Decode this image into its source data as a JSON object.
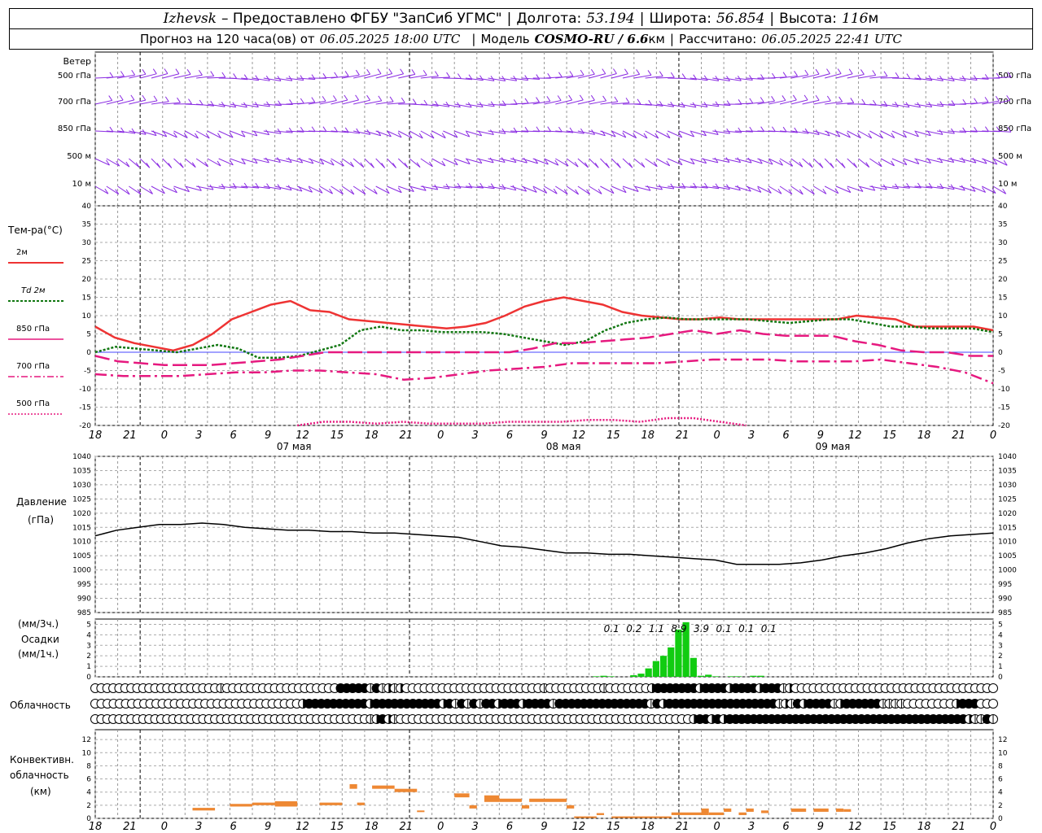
{
  "header": {
    "city": "Izhevsk",
    "provider": "– Предоставлено ФГБУ \"ЗапСиб УГМС\"",
    "lon_label": "Долгота:",
    "lon_value": "53.194",
    "lat_label": "Широта:",
    "lat_value": "56.854",
    "alt_label": "Высота:",
    "alt_value": "116",
    "alt_unit": "м",
    "forecast_prefix": "Прогноз на 120 часа(ов) от",
    "forecast_time": "06.05.2025 18:00 UTC",
    "model_label": "Модель",
    "model_value": "COSMO-RU / 6.6",
    "model_unit": "км",
    "computed_label": "Рассчитано:",
    "computed_time": "06.05.2025 22:41 UTC"
  },
  "colors": {
    "wind": "#8a2be2",
    "t2m": "#ee3333",
    "td2m": "#117711",
    "magenta": "#e6197f",
    "pressure": "#000000",
    "precip": "#11cc11",
    "conv": "#ee8833"
  },
  "labels": {
    "wind_title": "Ветер",
    "wind_levels": [
      "500 гПа",
      "700 гПа",
      "850 гПа",
      "500 м",
      "10  м"
    ],
    "temp_title": "Тем-ра(°C)",
    "legend": [
      "2м",
      "Td 2м",
      "850 гПа",
      "700 гПа",
      "500 гПа"
    ],
    "pressure_title": "Давление",
    "pressure_unit": "(гПа)",
    "precip_unit1": "(мм/3ч.)",
    "precip_title": "Осадки",
    "precip_unit2": "(мм/1ч.)",
    "cloud_title": "Облачность",
    "conv_title1": "Конвективн.",
    "conv_title2": "облачность",
    "conv_title3": "(км)"
  },
  "time_axis": {
    "ticks": [
      "18",
      "21",
      "0",
      "3",
      "6",
      "9",
      "12",
      "15",
      "18",
      "21",
      "0",
      "3",
      "6",
      "9",
      "12",
      "15",
      "18",
      "21",
      "0",
      "3",
      "6",
      "9",
      "12",
      "15",
      "18",
      "21",
      "0"
    ],
    "dates": [
      "07 мая",
      "08 мая",
      "09 мая"
    ]
  },
  "chart_data": [
    {
      "type": "line",
      "title": "Тем-ра(°C)",
      "ylim": [
        -20,
        40
      ],
      "yticks": [
        "40",
        "35",
        "30",
        "25",
        "20",
        "15",
        "10",
        "5",
        "0",
        "-5",
        "-10",
        "-15",
        "-20"
      ],
      "x_hours": [
        0,
        3,
        6,
        9,
        12,
        15,
        18,
        21,
        24,
        27,
        30,
        33,
        36,
        39,
        42,
        45,
        48,
        51,
        54,
        57,
        60,
        63,
        66,
        69,
        72,
        75,
        78,
        81,
        84,
        87,
        90,
        93,
        96,
        99,
        102,
        105,
        108,
        111,
        114,
        117,
        120
      ],
      "series": [
        {
          "name": "2м",
          "values": [
            7,
            4,
            2.5,
            1.5,
            0.5,
            2,
            5,
            9,
            11,
            13,
            14,
            11.5,
            11,
            9,
            8.5,
            8,
            7.5,
            7,
            6.5,
            7,
            8,
            10,
            12.5,
            14,
            15,
            14,
            13,
            11,
            10,
            9.5,
            9,
            9,
            9.5,
            9,
            9,
            9,
            9,
            9,
            9,
            10,
            9.5,
            9,
            7,
            7,
            7,
            7,
            6
          ]
        },
        {
          "name": "Td 2м",
          "values": [
            0,
            1.5,
            1,
            0.5,
            0,
            1,
            2,
            1,
            -1.5,
            -1.5,
            -1,
            0.5,
            2,
            6,
            7,
            6,
            6,
            5.5,
            5.5,
            5.5,
            5,
            4,
            3,
            2,
            3,
            6,
            8,
            9,
            9.5,
            9,
            9,
            9,
            9,
            8.5,
            8,
            8.5,
            9,
            9,
            8,
            7,
            7,
            6.5,
            6.5,
            6.5,
            5.5
          ]
        },
        {
          "name": "850 гПа",
          "values": [
            -1,
            -2.5,
            -3,
            -3.5,
            -3.5,
            -3.5,
            -3,
            -2.5,
            -2,
            -1,
            0,
            0,
            0,
            0,
            0,
            0,
            0,
            0,
            0,
            1,
            2.5,
            2.5,
            3,
            3.5,
            4,
            5,
            6,
            5,
            6,
            5,
            4.5,
            4.5,
            4.5,
            3,
            2,
            0.5,
            0,
            0,
            -1,
            -1
          ]
        },
        {
          "name": "700 гПа",
          "values": [
            -6,
            -6.5,
            -6.5,
            -6.5,
            -6,
            -5.5,
            -5.5,
            -5,
            -5,
            -5.5,
            -6,
            -7.5,
            -7,
            -6,
            -5,
            -4.5,
            -4,
            -3,
            -3,
            -3,
            -3,
            -2.5,
            -2,
            -2,
            -2,
            -2.5,
            -2.5,
            -2.5,
            -2,
            -3,
            -4,
            -5.5,
            -8.5
          ]
        },
        {
          "name": "500 гПа",
          "values": [
            -20,
            -19,
            -19,
            -19.5,
            -19,
            -19.5,
            -19.5,
            -19.5,
            -19,
            -19,
            -19,
            -18.5,
            -18.5,
            -19,
            -18,
            -18,
            -19,
            -20
          ]
        }
      ]
    },
    {
      "type": "line",
      "title": "Давление",
      "ylabel": "(гПа)",
      "ylim": [
        985,
        1040
      ],
      "yticks": [
        "1040",
        "1035",
        "1030",
        "1025",
        "1020",
        "1015",
        "1010",
        "1005",
        "1000",
        "995",
        "990",
        "985"
      ],
      "x_hours": [
        0,
        3,
        6,
        9,
        12,
        15,
        18,
        21,
        24,
        27,
        30,
        33,
        36,
        39,
        42,
        45,
        48,
        51,
        54,
        57,
        60,
        63,
        66,
        69,
        72,
        75,
        78,
        81,
        84,
        87,
        90,
        93,
        96,
        99,
        102,
        105,
        108,
        111,
        114,
        117,
        120
      ],
      "values": [
        1012,
        1014,
        1015,
        1016,
        1016,
        1016.5,
        1016,
        1015,
        1014.5,
        1014,
        1014,
        1013.5,
        1013.5,
        1013,
        1013,
        1012.5,
        1012,
        1011.5,
        1010,
        1008.5,
        1008,
        1007,
        1006,
        1006,
        1005.5,
        1005.5,
        1005,
        1004.5,
        1004,
        1003.5,
        1002,
        1002,
        1002,
        1002.5,
        1003.5,
        1005,
        1006,
        1007.5,
        1009.5,
        1011,
        1012,
        1012.5,
        1013
      ]
    },
    {
      "type": "bar",
      "title": "Осадки",
      "ylabel": "(мм/1ч.)",
      "ylim": [
        0,
        5
      ],
      "yticks": [
        "5",
        "4",
        "3",
        "2",
        "1",
        "0"
      ],
      "x_hours": [
        67,
        68,
        69,
        70,
        71,
        72,
        73,
        74,
        75,
        76,
        77,
        78,
        79,
        80,
        81,
        82,
        83,
        84,
        85,
        86,
        87,
        88,
        89,
        90
      ],
      "values": [
        0.05,
        0.1,
        0.05,
        0,
        0,
        0.15,
        0.3,
        0.8,
        1.5,
        2,
        2.8,
        4.5,
        5.2,
        1.8,
        0.1,
        0.2,
        0.05,
        0,
        0.05,
        0.05,
        0,
        0.1,
        0.1,
        0
      ],
      "annotations": [
        {
          "x": 69,
          "text": "0.1"
        },
        {
          "x": 72,
          "text": "0.2"
        },
        {
          "x": 75,
          "text": "1.1"
        },
        {
          "x": 78,
          "text": "8.9"
        },
        {
          "x": 81,
          "text": "3.9"
        },
        {
          "x": 84,
          "text": "0.1"
        },
        {
          "x": 87,
          "text": "0.1"
        },
        {
          "x": 90,
          "text": "0.1"
        }
      ]
    },
    {
      "type": "heatmap",
      "title": "Облачность",
      "x_hours_step": 1,
      "rows": [
        {
          "level": "upper",
          "values": "ooooooooooooooooooooolooooooooooooooooooo#####l#lhlhoooooooooooooooooooooooloooooooooloooooooh#######h####h####h###lhoooooooooooooooooooooooooooooooooo"
        },
        {
          "level": "middle",
          "values": "ooooooooooooooooooooooooooooooooooh##########h###########h#l#l#l##h###h####l###############l#h##################lhl#h####lh######llllooooooooh###ooo"
        },
        {
          "level": "lower",
          "values": "oooooooooooooooooooooooooooooooooooooooooooooolh#hloooooooooooooooooooooooooooooooooooooooooooooooooh##h#h########################################hll#l"
        }
      ]
    },
    {
      "type": "bar",
      "title": "Конвективн. облачность",
      "ylabel": "(км)",
      "ylim": [
        0,
        13
      ],
      "yticks": [
        "12",
        "10",
        "8",
        "6",
        "4",
        "2",
        "0"
      ],
      "segments": [
        {
          "x0": 13,
          "x1": 16,
          "bottom": 1.2,
          "top": 1.6
        },
        {
          "x0": 18,
          "x1": 21,
          "bottom": 1.8,
          "top": 2.2
        },
        {
          "x0": 21,
          "x1": 24,
          "bottom": 2.0,
          "top": 2.4
        },
        {
          "x0": 24,
          "x1": 27,
          "bottom": 1.8,
          "top": 2.6
        },
        {
          "x0": 30,
          "x1": 33,
          "bottom": 2.0,
          "top": 2.4
        },
        {
          "x0": 34,
          "x1": 35,
          "bottom": 4.5,
          "top": 5.2
        },
        {
          "x0": 35,
          "x1": 36,
          "bottom": 2.0,
          "top": 2.4
        },
        {
          "x0": 37,
          "x1": 40,
          "bottom": 4.5,
          "top": 5.0
        },
        {
          "x0": 40,
          "x1": 43,
          "bottom": 4.0,
          "top": 4.5
        },
        {
          "x0": 43,
          "x1": 44,
          "bottom": 1.0,
          "top": 1.2
        },
        {
          "x0": 48,
          "x1": 50,
          "bottom": 3.2,
          "top": 3.8
        },
        {
          "x0": 50,
          "x1": 51,
          "bottom": 1.5,
          "top": 2.0
        },
        {
          "x0": 52,
          "x1": 54,
          "bottom": 2.5,
          "top": 3.5
        },
        {
          "x0": 54,
          "x1": 57,
          "bottom": 2.5,
          "top": 3.0
        },
        {
          "x0": 57,
          "x1": 58,
          "bottom": 1.5,
          "top": 2.0
        },
        {
          "x0": 58,
          "x1": 60,
          "bottom": 2.5,
          "top": 3.0
        },
        {
          "x0": 60,
          "x1": 63,
          "bottom": 2.5,
          "top": 3.0
        },
        {
          "x0": 63,
          "x1": 64,
          "bottom": 1.5,
          "top": 2.0
        },
        {
          "x0": 64,
          "x1": 67,
          "bottom": 0.1,
          "top": 0.3
        },
        {
          "x0": 67,
          "x1": 68,
          "bottom": 0.5,
          "top": 0.8
        },
        {
          "x0": 69,
          "x1": 77,
          "bottom": 0.1,
          "top": 0.3
        },
        {
          "x0": 77,
          "x1": 81,
          "bottom": 0.5,
          "top": 0.9
        },
        {
          "x0": 81,
          "x1": 82,
          "bottom": 0.5,
          "top": 1.5
        },
        {
          "x0": 82,
          "x1": 84,
          "bottom": 0.5,
          "top": 0.9
        },
        {
          "x0": 84,
          "x1": 85,
          "bottom": 1.0,
          "top": 1.5
        },
        {
          "x0": 86,
          "x1": 87,
          "bottom": 0.5,
          "top": 0.9
        },
        {
          "x0": 87,
          "x1": 88,
          "bottom": 1.0,
          "top": 1.5
        },
        {
          "x0": 89,
          "x1": 90,
          "bottom": 0.8,
          "top": 1.2
        },
        {
          "x0": 93,
          "x1": 95,
          "bottom": 1.0,
          "top": 1.5
        },
        {
          "x0": 96,
          "x1": 98,
          "bottom": 1.0,
          "top": 1.5
        },
        {
          "x0": 99,
          "x1": 100,
          "bottom": 1.0,
          "top": 1.5
        },
        {
          "x0": 100,
          "x1": 101,
          "bottom": 1.0,
          "top": 1.4
        }
      ]
    }
  ]
}
